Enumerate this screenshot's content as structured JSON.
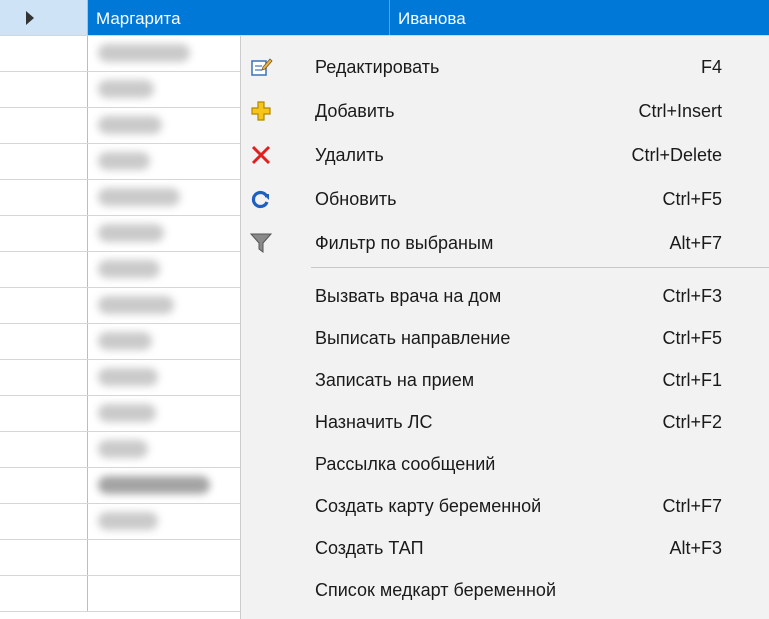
{
  "grid": {
    "selected_row": {
      "first_name": "Маргарита",
      "last_name": "Иванова"
    }
  },
  "context_menu": {
    "items": [
      {
        "label": "Редактировать",
        "shortcut": "F4",
        "icon": "edit-icon"
      },
      {
        "label": "Добавить",
        "shortcut": "Ctrl+Insert",
        "icon": "add-icon"
      },
      {
        "label": "Удалить",
        "shortcut": "Ctrl+Delete",
        "icon": "delete-icon"
      },
      {
        "label": "Обновить",
        "shortcut": "Ctrl+F5",
        "icon": "refresh-icon"
      },
      {
        "label": "Фильтр по выбраным",
        "shortcut": "Alt+F7",
        "icon": "filter-icon"
      },
      {
        "label": "Вызвать врача на дом",
        "shortcut": "Ctrl+F3"
      },
      {
        "label": "Выписать направление",
        "shortcut": "Ctrl+F5"
      },
      {
        "label": "Записать на прием",
        "shortcut": "Ctrl+F1"
      },
      {
        "label": "Назначить ЛС",
        "shortcut": "Ctrl+F2"
      },
      {
        "label": "Рассылка сообщений",
        "shortcut": ""
      },
      {
        "label": "Создать карту беременной",
        "shortcut": "Ctrl+F7"
      },
      {
        "label": "Создать ТАП",
        "shortcut": "Alt+F3"
      },
      {
        "label": "Список медкарт беременной",
        "shortcut": ""
      }
    ]
  },
  "colors": {
    "selection": "#0078d7",
    "row_header_selected": "#cfe3f6",
    "menu_bg": "#f2f2f2"
  }
}
